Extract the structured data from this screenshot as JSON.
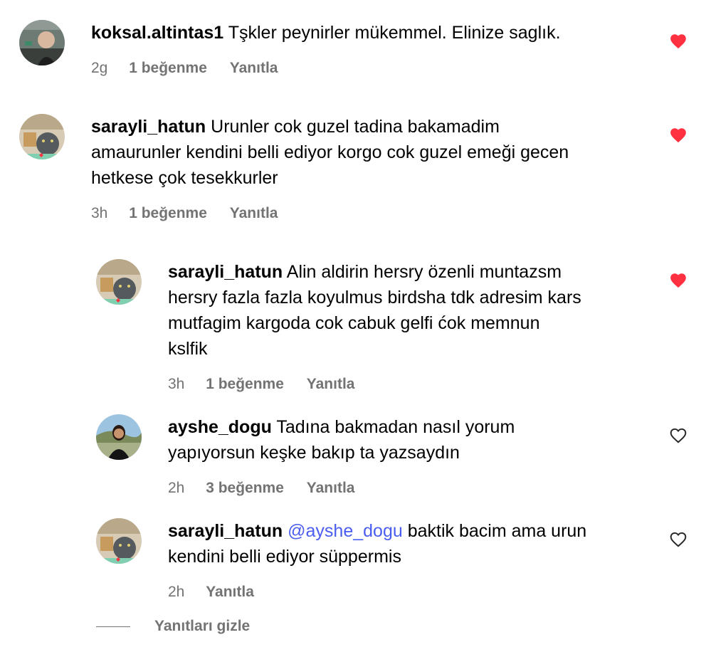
{
  "colors": {
    "heart_filled": "#ff3040",
    "meta_text": "#737373",
    "mention": "#4a5df0"
  },
  "comments": [
    {
      "username": "koksal.altintas1",
      "text": "Tşkler peynirler mükemmel. Elinize saglık.",
      "time": "2g",
      "likes": "1 beğenme",
      "reply": "Yanıtla",
      "liked": true,
      "heart_icon": "heart-filled-icon"
    },
    {
      "username": "sarayli_hatun",
      "text_lines": [
        "Urunler cok guzel tadina bakamadim",
        "amaurunler kendini belli ediyor korgo cok guzel emeği gecen",
        "hetkese çok tesekkurler"
      ],
      "time": "3h",
      "likes": "1 beğenme",
      "reply": "Yanıtla",
      "liked": true,
      "heart_icon": "heart-filled-icon"
    }
  ],
  "replies": [
    {
      "username": "sarayli_hatun",
      "text_lines": [
        "Alin aldirin hersry özenli muntazsm",
        "hersry fazla fazla koyulmus birdsha tdk adresim kars",
        "mutfagim kargoda cok cabuk gelfi ćok memnun",
        "kslfik"
      ],
      "time": "3h",
      "likes": "1 beğenme",
      "reply": "Yanıtla",
      "liked": true,
      "heart_icon": "heart-filled-icon"
    },
    {
      "username": "ayshe_dogu",
      "text_lines": [
        "Tadına bakmadan nasıl yorum",
        "yapıyorsun keşke bakıp ta yazsaydın"
      ],
      "time": "2h",
      "likes": "3 beğenme",
      "reply": "Yanıtla",
      "liked": false,
      "heart_icon": "heart-outline-icon"
    },
    {
      "username": "sarayli_hatun",
      "mention": "@ayshe_dogu",
      "text_lines": [
        "baktik bacim ama urun",
        "kendini belli ediyor süppermis"
      ],
      "time": "2h",
      "reply": "Yanıtla",
      "liked": false,
      "heart_icon": "heart-outline-icon"
    }
  ],
  "hide_replies_label": "Yanıtları gizle"
}
